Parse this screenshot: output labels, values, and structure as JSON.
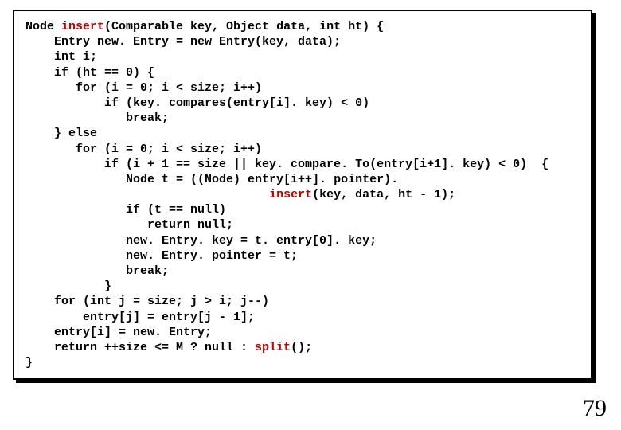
{
  "code": {
    "t00a": "Node ",
    "t00b": "insert",
    "t00c": "(Comparable key, Object data, int ht) {",
    "t01": "    Entry new. Entry = new Entry(key, data);",
    "t02": "    int i;",
    "t03": "    if (ht == 0) {",
    "t04": "       for (i = 0; i < size; i++)",
    "t05": "           if (key. compares(entry[i]. key) < 0)",
    "t06": "              break;",
    "t07": "    } else",
    "t08": "       for (i = 0; i < size; i++)",
    "t09": "           if (i + 1 == size || key. compare. To(entry[i+1]. key) < 0)  {",
    "t10a": "              Node t = ((Node) entry[i++]. pointer).",
    "t10b": "                                  ",
    "t10c": "insert",
    "t10d": "(key, data, ht - 1);",
    "t11": "              if (t == null)",
    "t12": "                 return null;",
    "t13": "              new. Entry. key = t. entry[0]. key;",
    "t14": "              new. Entry. pointer = t;",
    "t15": "              break;",
    "t16": "           }",
    "t17": "    for (int j = size; j > i; j--)",
    "t18": "        entry[j] = entry[j - 1];",
    "t19": "    entry[i] = new. Entry;",
    "t20a": "    return ++size <= M ? null : ",
    "t20b": "split",
    "t20c": "();",
    "t21": "}"
  },
  "page_number": "79"
}
